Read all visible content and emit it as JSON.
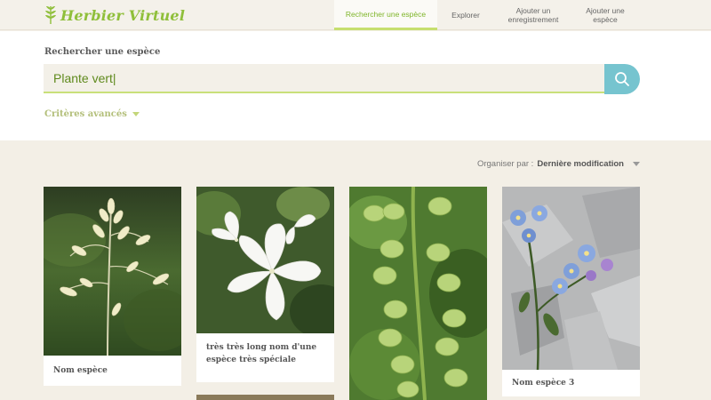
{
  "header": {
    "logo_text": "Herbier Virtuel",
    "nav": [
      {
        "label": "Rechercher une espèce",
        "active": true
      },
      {
        "label": "Explorer",
        "active": false
      },
      {
        "label": "Ajouter un enregistrement",
        "active": false
      },
      {
        "label": "Ajouter une espèce",
        "active": false
      }
    ]
  },
  "search": {
    "title": "Rechercher une espèce",
    "value": "Plante vert|",
    "advanced_label": "Critères avancés"
  },
  "sort": {
    "label": "Organiser par :",
    "value": "Dernière modification"
  },
  "cards": [
    {
      "label": "Nom espèce",
      "image": "grass-flower-image"
    },
    {
      "label": "très très long nom d'une espèce très spéciale",
      "image": "white-mallow-image"
    },
    {
      "label": "",
      "image": "green-seedpods-image"
    },
    {
      "label": "Nom espèce 3",
      "image": "blue-forget-me-not-image"
    }
  ],
  "colors": {
    "brand_green": "#8fbf3a",
    "accent_blue": "#76c4cf",
    "background": "#f3efe6"
  }
}
